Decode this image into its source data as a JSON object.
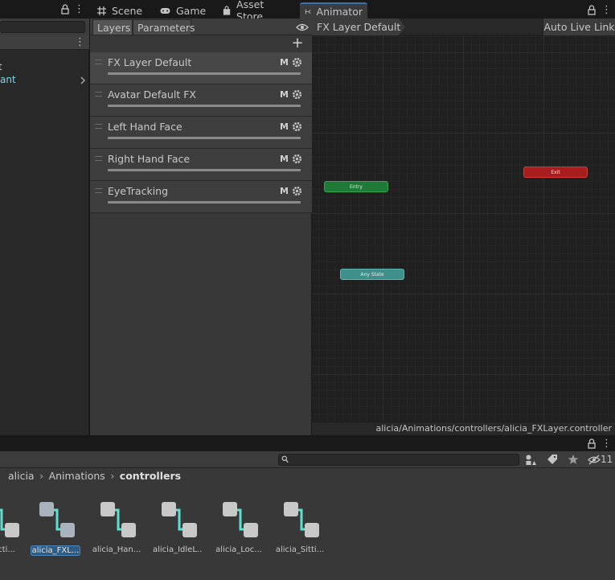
{
  "tabs": [
    {
      "label": "Scene",
      "icon": "grid-icon"
    },
    {
      "label": "Game",
      "icon": "gamepad-icon"
    },
    {
      "label": "Asset Store",
      "icon": "bag-icon"
    },
    {
      "label": "Animator",
      "icon": "animator-icon"
    }
  ],
  "hierarchy": {
    "items": [
      {
        "label": "t"
      },
      {
        "label": "ant"
      }
    ]
  },
  "layers_panel": {
    "tab_layers": "Layers",
    "tab_parameters": "Parameters",
    "layers": [
      {
        "name": "FX Layer Default",
        "badge": "M"
      },
      {
        "name": "Avatar Default FX",
        "badge": "M"
      },
      {
        "name": "Left Hand Face",
        "badge": "M"
      },
      {
        "name": "Right Hand Face",
        "badge": "M"
      },
      {
        "name": "EyeTracking",
        "badge": "M"
      }
    ],
    "add_label": "+"
  },
  "graph": {
    "breadcrumb": "FX Layer Default",
    "live_link": "Auto Live Link",
    "nodes": {
      "entry": "Entry",
      "exit": "Exit",
      "any_state": "Any State"
    },
    "status_path": "alicia/Animations/controllers/alicia_FXLayer.controller"
  },
  "project": {
    "breadcrumbs": [
      "alicia",
      "Animations",
      "controllers"
    ],
    "hidden_count": "11",
    "search_value": "",
    "assets": [
      {
        "label": "...Acti..."
      },
      {
        "label": "alicia_FXL..."
      },
      {
        "label": "alicia_Han..."
      },
      {
        "label": "alicia_IdleL..."
      },
      {
        "label": "alicia_Loc..."
      },
      {
        "label": "alicia_Sitti..."
      }
    ]
  },
  "colors": {
    "entry": "#1e7a36",
    "exit": "#a81e1e",
    "any_state": "#3f8f8a",
    "selection": "#2c5d87",
    "link_cyan": "#7fd6e6"
  }
}
